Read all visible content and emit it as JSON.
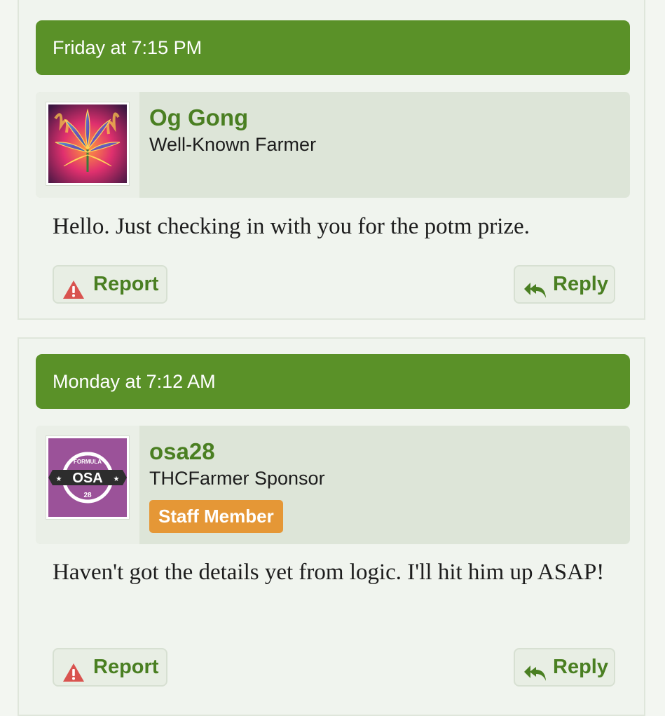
{
  "posts": [
    {
      "timestamp": "Friday at 7:15 PM",
      "username": "Og Gong",
      "user_title": "Well-Known Farmer",
      "message": "Hello. Just checking in with you for the potm prize.",
      "report_label": "Report",
      "reply_label": "Reply"
    },
    {
      "timestamp": "Monday at 7:12 AM",
      "username": "osa28",
      "user_title": "THCFarmer Sponsor",
      "badge": "Staff Member",
      "avatar_text": {
        "top": "FORMULA",
        "main": "OSA",
        "bottom": "28"
      },
      "message": "Haven't got the details yet from logic. I'll hit him up ASAP!",
      "report_label": "Report",
      "reply_label": "Reply"
    }
  ],
  "icons": {
    "report": "warning-triangle-icon",
    "reply": "reply-arrow-icon"
  },
  "colors": {
    "header_green": "#5a9128",
    "username_green": "#4a7f22",
    "staff_badge": "#e59736",
    "report_red": "#d9534f"
  }
}
